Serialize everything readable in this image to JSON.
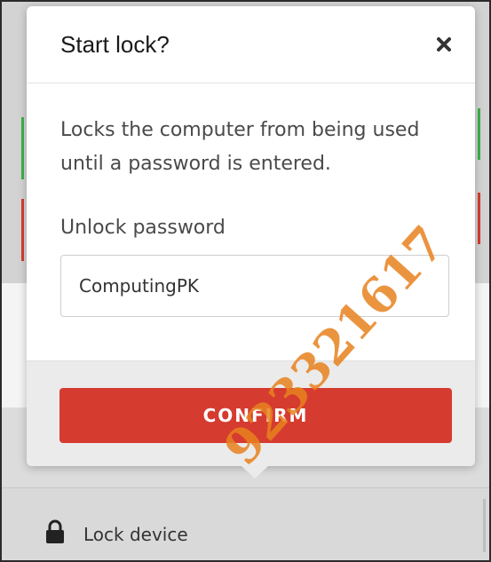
{
  "modal": {
    "title": "Start lock?",
    "close_icon": "close-icon",
    "description": "Locks the computer from being used until a password is entered.",
    "password_label": "Unlock password",
    "password_value": "ComputingPK",
    "confirm_label": "CONFIRM"
  },
  "background": {
    "lock_item_label": "Lock device",
    "lock_icon": "lock-icon"
  },
  "watermark": {
    "text": "923321617"
  },
  "colors": {
    "confirm_button": "#d63b30",
    "status_green": "#3cb34a",
    "status_red": "#d63c2f",
    "watermark": "#e8821f"
  }
}
